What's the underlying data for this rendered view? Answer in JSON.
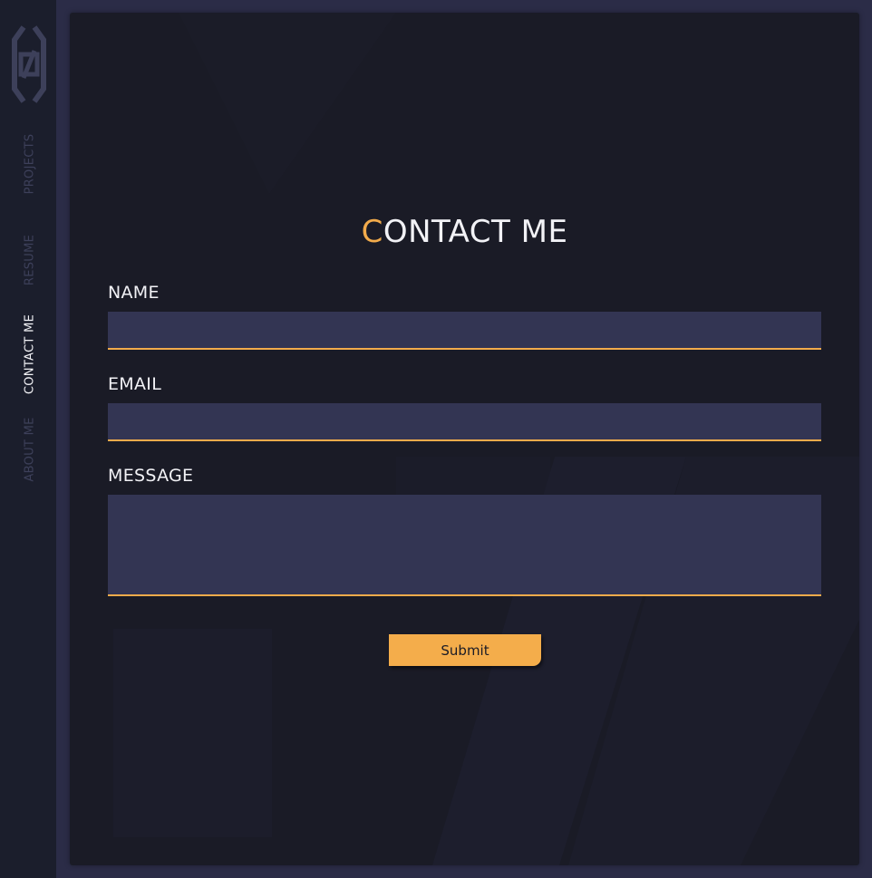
{
  "colors": {
    "accent": "#f2ab4b",
    "sidebar_bg": "#1b1e2c",
    "panel_bg": "#1a1b26",
    "input_bg": "#333553",
    "frame_bg": "#2b2c47"
  },
  "sidebar": {
    "logo_icon": "code-brackets-logo",
    "items": [
      {
        "label": "PROJECTS",
        "active": false
      },
      {
        "label": "RESUME",
        "active": false
      },
      {
        "label": "CONTACT ME",
        "active": true
      },
      {
        "label": "ABOUT ME",
        "active": false
      }
    ]
  },
  "contact": {
    "title_first": "C",
    "title_rest": "ONTACT ME",
    "fields": {
      "name": {
        "label": "NAME",
        "value": ""
      },
      "email": {
        "label": "EMAIL",
        "value": ""
      },
      "message": {
        "label": "MESSAGE",
        "value": ""
      }
    },
    "submit_label": "Submit"
  }
}
